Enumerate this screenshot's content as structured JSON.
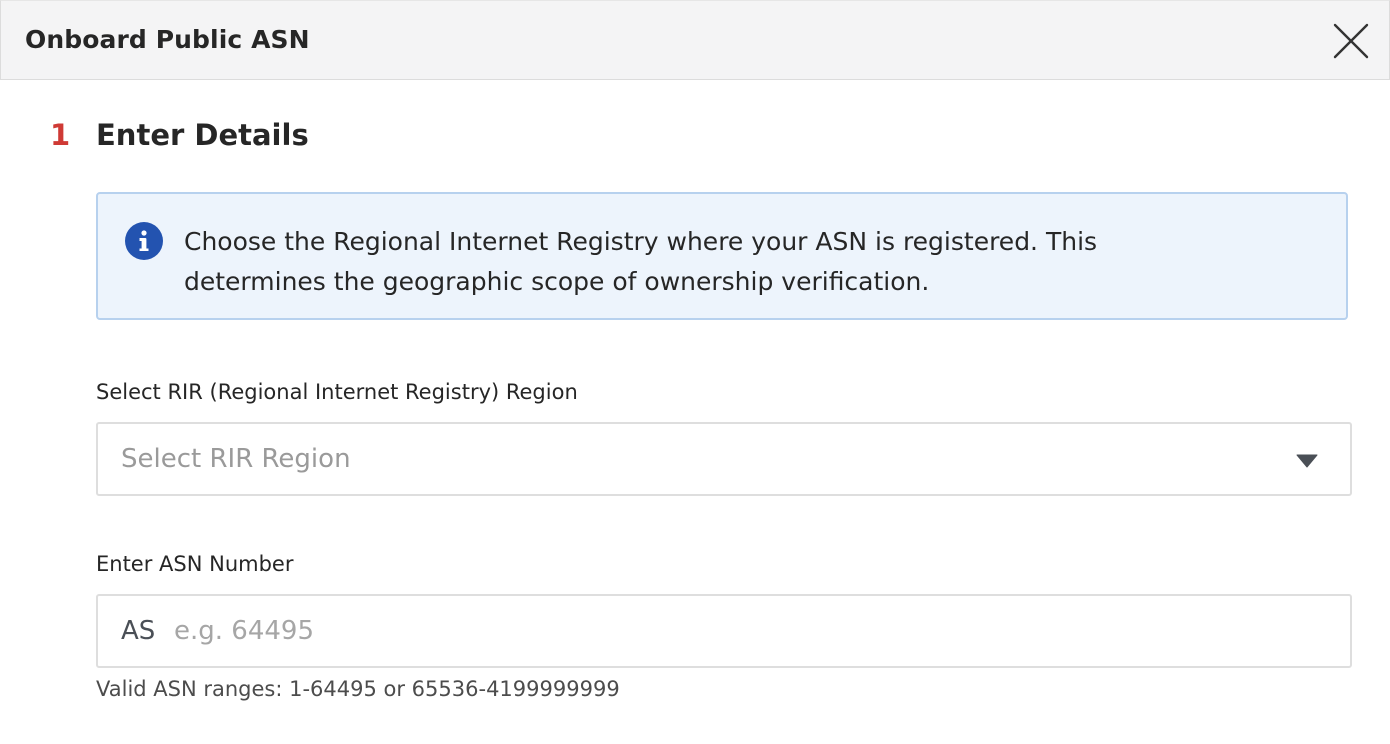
{
  "dialog": {
    "title": "Onboard Public ASN",
    "close_icon": "close-icon"
  },
  "step": {
    "number": "1",
    "title": "Enter Details"
  },
  "info_banner": {
    "icon": "info-icon",
    "text": "Choose the Regional Internet Registry where your ASN is registered. This determines the geographic scope of ownership verification."
  },
  "rir_field": {
    "label": "Select RIR (Regional Internet Registry) Region",
    "placeholder": "Select RIR Region",
    "icon": "caret-down-icon"
  },
  "asn_field": {
    "label": "Enter ASN Number",
    "prefix": "AS",
    "placeholder": "e.g. 64495",
    "value": "",
    "helper": "Valid ASN ranges: 1-64495 or 65536-4199999999"
  },
  "colors": {
    "step_accent": "#cf3a35",
    "info_bg": "#edf4fc",
    "info_border": "#b7d1ee",
    "info_icon": "#2353b0"
  }
}
